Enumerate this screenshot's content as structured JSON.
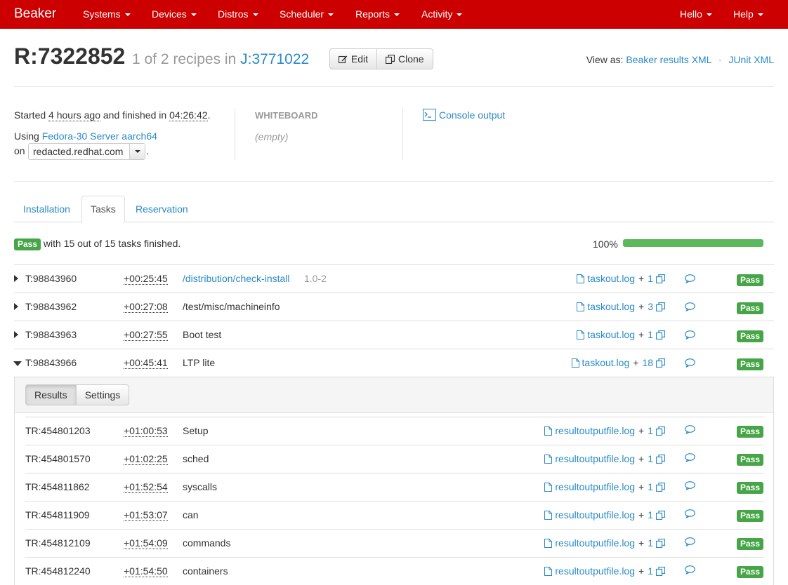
{
  "navbar": {
    "brand": "Beaker",
    "menus": [
      "Systems",
      "Devices",
      "Distros",
      "Scheduler",
      "Reports",
      "Activity"
    ],
    "right_menus": [
      "Hello",
      "Help"
    ]
  },
  "header": {
    "recipe_id": "R:7322852",
    "subtitle_prefix": "1 of 2 recipes in",
    "job_id": "J:3771022",
    "edit_label": "Edit",
    "clone_label": "Clone",
    "view_as_label": "View as:",
    "beaker_xml_link": "Beaker results XML",
    "separator": "·",
    "junit_xml_link": "JUnit XML"
  },
  "summary": {
    "started_prefix": "Started",
    "started_ago": "4 hours ago",
    "finished_mid": "and finished in",
    "duration": "04:26:42",
    "period": ".",
    "using_prefix": "Using",
    "distro": "Fedora-30 Server aarch64",
    "on_prefix": "on",
    "host": "redacted.redhat.com",
    "whiteboard_label": "WHITEBOARD",
    "whiteboard_value": "(empty)",
    "console_label": "Console output"
  },
  "tabs": [
    "Installation",
    "Tasks",
    "Reservation"
  ],
  "active_tab": "Tasks",
  "status": {
    "result": "Pass",
    "text": "with 15 out of 15 tasks finished.",
    "percent_label": "100%",
    "progress": 1.0
  },
  "tasks": [
    {
      "id": "T:98843960",
      "duration": "+00:25:45",
      "name": "/distribution/check-install",
      "name_is_link": true,
      "version": "1.0-2",
      "log": "taskout.log",
      "extra": "1",
      "result": "Pass",
      "expanded": false
    },
    {
      "id": "T:98843962",
      "duration": "+00:27:08",
      "name": "/test/misc/machineinfo",
      "name_is_link": false,
      "version": "",
      "log": "taskout.log",
      "extra": "3",
      "result": "Pass",
      "expanded": false
    },
    {
      "id": "T:98843963",
      "duration": "+00:27:55",
      "name": "Boot test",
      "name_is_link": false,
      "version": "",
      "log": "taskout.log",
      "extra": "1",
      "result": "Pass",
      "expanded": false
    },
    {
      "id": "T:98843966",
      "duration": "+00:45:41",
      "name": "LTP lite",
      "name_is_link": false,
      "version": "",
      "log": "taskout.log",
      "extra": "18",
      "result": "Pass",
      "expanded": true
    }
  ],
  "expanded_task": {
    "subtabs": [
      "Results",
      "Settings"
    ],
    "results": [
      {
        "id": "TR:454801203",
        "duration": "+01:00:53",
        "name": "Setup",
        "log": "resultoutputfile.log",
        "extra": "1",
        "result": "Pass"
      },
      {
        "id": "TR:454801570",
        "duration": "+01:02:25",
        "name": "sched",
        "log": "resultoutputfile.log",
        "extra": "1",
        "result": "Pass"
      },
      {
        "id": "TR:454811862",
        "duration": "+01:52:54",
        "name": "syscalls",
        "log": "resultoutputfile.log",
        "extra": "1",
        "result": "Pass"
      },
      {
        "id": "TR:454811909",
        "duration": "+01:53:07",
        "name": "can",
        "log": "resultoutputfile.log",
        "extra": "1",
        "result": "Pass"
      },
      {
        "id": "TR:454812109",
        "duration": "+01:54:09",
        "name": "commands",
        "log": "resultoutputfile.log",
        "extra": "1",
        "result": "Pass"
      },
      {
        "id": "TR:454812240",
        "duration": "+01:54:50",
        "name": "containers",
        "log": "resultoutputfile.log",
        "extra": "1",
        "result": "Pass"
      }
    ]
  },
  "colors": {
    "navbar": "#cc0000",
    "link": "#2a8ac9",
    "pass_badge": "#46a546",
    "progress_fill": "#5cb85c"
  }
}
